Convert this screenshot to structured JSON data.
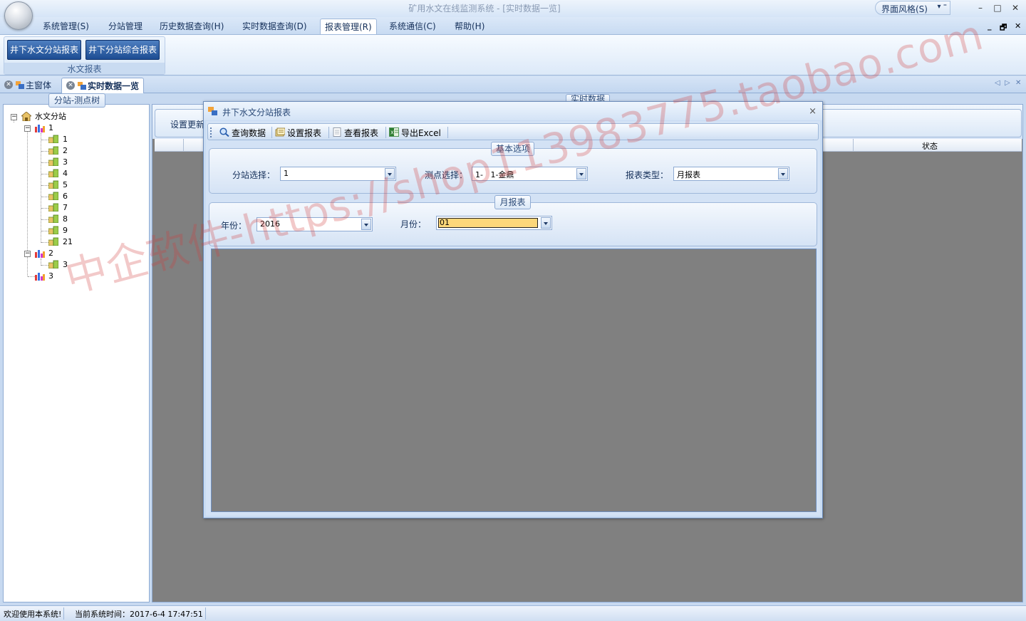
{
  "window": {
    "title": "矿用水文在线监测系统 - [实时数据一览]",
    "skin_menu_label": "界面风格(S)",
    "minimize": "–",
    "maximize": "□",
    "close": "✕"
  },
  "menu": {
    "items": [
      {
        "label": "系统管理(S)"
      },
      {
        "label": "分站管理"
      },
      {
        "label": "历史数据查询(H)"
      },
      {
        "label": "实时数据查询(D)"
      },
      {
        "label": "报表管理(R)"
      },
      {
        "label": "系统通信(C)"
      },
      {
        "label": "帮助(H)"
      }
    ],
    "active_index": 4,
    "mdi_controls": [
      "_",
      "🗗",
      "✕"
    ]
  },
  "ribbon": {
    "buttons": [
      {
        "label": "井下水文分站报表"
      },
      {
        "label": "井下分站综合报表"
      }
    ],
    "group_label": "水文报表"
  },
  "doc_tabs": [
    {
      "label": "主窗体"
    },
    {
      "label": "实时数据一览"
    }
  ],
  "left_panel": {
    "caption": "分站-测点树",
    "root": "水文分站",
    "nodes": [
      {
        "label": "1",
        "children": [
          "1",
          "2",
          "3",
          "4",
          "5",
          "6",
          "7",
          "8",
          "9",
          "21"
        ]
      },
      {
        "label": "2",
        "children": [
          "3"
        ]
      },
      {
        "label": "3",
        "children": []
      }
    ]
  },
  "right_panel": {
    "caption": "实时数据",
    "toolbar_text": "设置更新",
    "status_column": "状态"
  },
  "dialog": {
    "title": "井下水文分站报表",
    "close": "×",
    "toolbar": [
      {
        "label": "查询数据",
        "icon": "search-icon"
      },
      {
        "label": "设置报表",
        "icon": "settings-report-icon"
      },
      {
        "label": "查看报表",
        "icon": "document-icon"
      },
      {
        "label": "导出Excel",
        "icon": "excel-icon"
      }
    ],
    "basic_options": {
      "caption": "基本选项",
      "station_label": "分站选择：",
      "station_value": "1",
      "point_label": "测点选择：",
      "point_value": "1-   1-金鼎",
      "type_label": "报表类型：",
      "type_value": "月报表"
    },
    "monthly": {
      "caption": "月报表",
      "year_label": "年份：",
      "year_value": "2016",
      "month_label": "月份：",
      "month_value": "01"
    }
  },
  "statusbar": {
    "welcome": "欢迎使用本系统!",
    "time": "当前系统时间：2017-6-4  17:47:51"
  },
  "watermark": "中企软件-https://shop113983775.taobao.com"
}
